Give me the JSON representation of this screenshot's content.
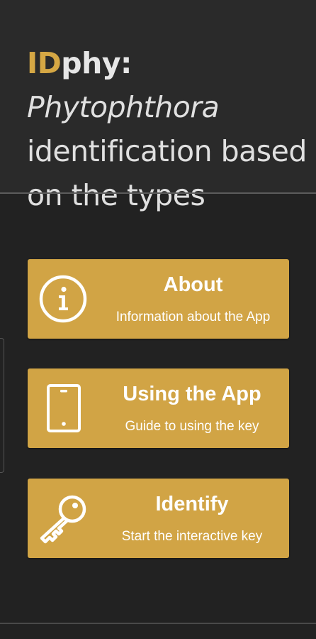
{
  "header": {
    "title_id": "ID",
    "title_brand_rest": "phy:",
    "title_genus": "Phytophthora",
    "title_line2": "identification based",
    "title_line3": "on the types"
  },
  "menu": [
    {
      "title": "About",
      "subtitle": "Information about the App",
      "icon": "info-icon"
    },
    {
      "title": "Using the App",
      "subtitle": "Guide to using the key",
      "icon": "tablet-icon"
    },
    {
      "title": "Identify",
      "subtitle": "Start the interactive key",
      "icon": "key-icon"
    }
  ],
  "colors": {
    "background": "#222222",
    "header_background": "#2a2a2a",
    "accent": "#d1a445",
    "brand_id": "#d5a744",
    "text_light": "#e0e0e0"
  }
}
